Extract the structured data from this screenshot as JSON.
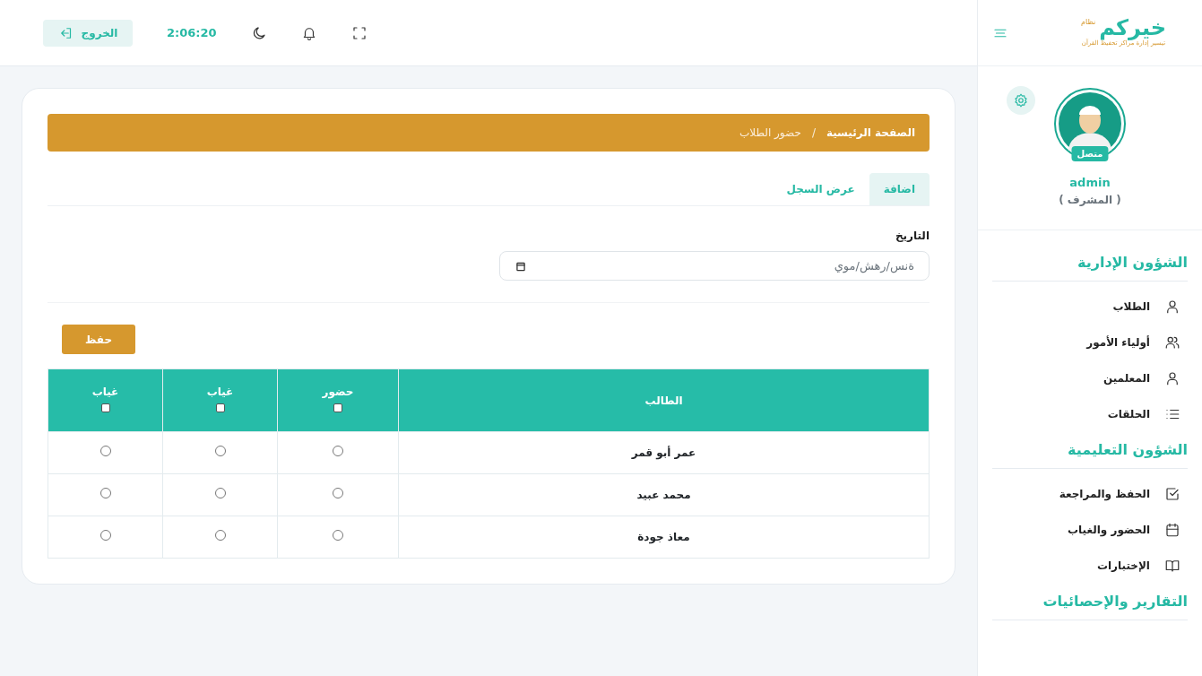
{
  "logo": {
    "small": "نظام",
    "title": "خيركم",
    "tagline": "تيسير إدارة مراكز تحفيظ القرآن"
  },
  "header": {
    "clock": "2:06:20",
    "logout": "الخروج"
  },
  "profile": {
    "status": "متصل",
    "username": "admin",
    "role": "( المشرف )"
  },
  "sidebar": {
    "sections": [
      {
        "title": "الشؤون الإدارية",
        "items": [
          {
            "label": "الطلاب",
            "kind": "user"
          },
          {
            "label": "أولياء الأمور",
            "kind": "users"
          },
          {
            "label": "المعلمين",
            "kind": "user"
          },
          {
            "label": "الحلقات",
            "kind": "list"
          }
        ]
      },
      {
        "title": "الشؤون التعليمية",
        "items": [
          {
            "label": "الحفظ والمراجعة",
            "kind": "check"
          },
          {
            "label": "الحضور والغياب",
            "kind": "calendar"
          },
          {
            "label": "الإختبارات",
            "kind": "book"
          }
        ]
      },
      {
        "title": "التقارير والإحصائيات"
      }
    ]
  },
  "breadcrumb": {
    "separator": "/",
    "items": [
      {
        "label": "الصفحة الرئيسية",
        "current": false
      },
      {
        "label": "حضور الطلاب",
        "current": true
      }
    ]
  },
  "tabs": [
    {
      "label": "اضافة",
      "selected": true
    },
    {
      "label": "عرض السجل",
      "selected": false
    }
  ],
  "date_field": {
    "label": "التاريخ",
    "value": "ةنس/رهش/موي"
  },
  "save_button": "حفظ",
  "table": {
    "columns": [
      {
        "label": "الطالب",
        "kind": "text"
      },
      {
        "label": "حضور",
        "kind": "choice",
        "checked": false
      },
      {
        "label": "غياب",
        "kind": "choice",
        "checked": false
      },
      {
        "label": "غياب",
        "kind": "choice",
        "checked": false
      }
    ],
    "rows": [
      {
        "student": "عمر أبو قمر",
        "marks": [
          {
            "checked": false
          },
          {
            "checked": false
          },
          {
            "checked": false
          }
        ]
      },
      {
        "student": "محمد عبيد",
        "marks": [
          {
            "checked": false
          },
          {
            "checked": false
          },
          {
            "checked": false
          }
        ]
      },
      {
        "student": "معاذ جودة",
        "marks": [
          {
            "checked": false
          },
          {
            "checked": false
          },
          {
            "checked": false
          }
        ]
      }
    ]
  }
}
